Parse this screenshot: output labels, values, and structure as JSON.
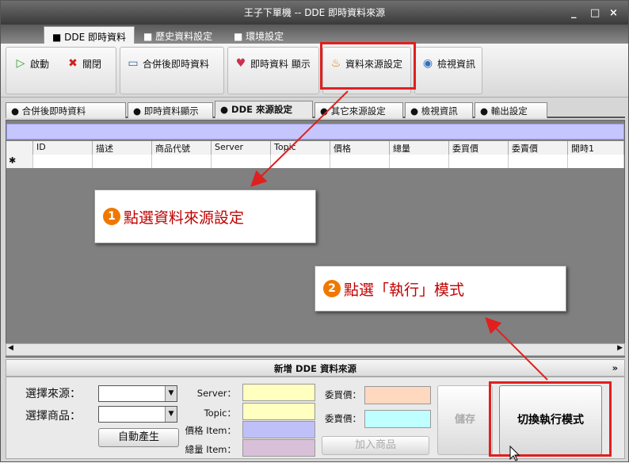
{
  "window": {
    "title": "王子下單機  -- DDE 即時資料來源",
    "minimize": "_",
    "maximize": "□",
    "close": "×"
  },
  "top_tabs": [
    {
      "label": "■ DDE 即時資料"
    },
    {
      "label": "■ 歷史資料設定"
    },
    {
      "label": "■ 環境設定"
    }
  ],
  "ribbon": {
    "start": "啟動",
    "stop": "關閉",
    "merge": "合併後即時資料",
    "realtime": "即時資料 顯示",
    "source": "資料來源設定",
    "inspect": "檢視資訊"
  },
  "sub_tabs": [
    {
      "label": "● 合併後即時資料"
    },
    {
      "label": "● 即時資料顯示"
    },
    {
      "label": "● DDE 來源設定"
    },
    {
      "label": "● 其它來源設定"
    },
    {
      "label": "● 檢視資訊"
    },
    {
      "label": "● 輸出設定"
    }
  ],
  "grid": {
    "columns": [
      "ID",
      "描述",
      "商品代號",
      "Server",
      "Topic",
      "價格",
      "總量",
      "委買價",
      "委賣價",
      "開時1"
    ],
    "new_row_marker": "✱"
  },
  "callouts": {
    "one_num": "1",
    "one_text": "點選資料來源設定",
    "two_num": "2",
    "two_text": "點選「執行」模式"
  },
  "panel": {
    "header": "新增 DDE 資料來源",
    "collapse": "»",
    "select_source": "選擇來源：",
    "select_product": "選擇商品：",
    "auto_generate": "自動產生",
    "server": "Server：",
    "topic": "Topic：",
    "price_item": "價格 Item：",
    "volume_item": "總量 Item：",
    "bid": "委買價：",
    "ask": "委賣價：",
    "add_product": "加入商品",
    "save": "儲存",
    "switch_mode": "切換執行模式"
  },
  "colors": {
    "server": "#ffffc0",
    "topic": "#ffffc0",
    "price": "#c0c0f8",
    "volume": "#d8c0d8",
    "bid": "#ffd8c0",
    "ask": "#c0ffff",
    "accent_red": "#e0201f"
  }
}
